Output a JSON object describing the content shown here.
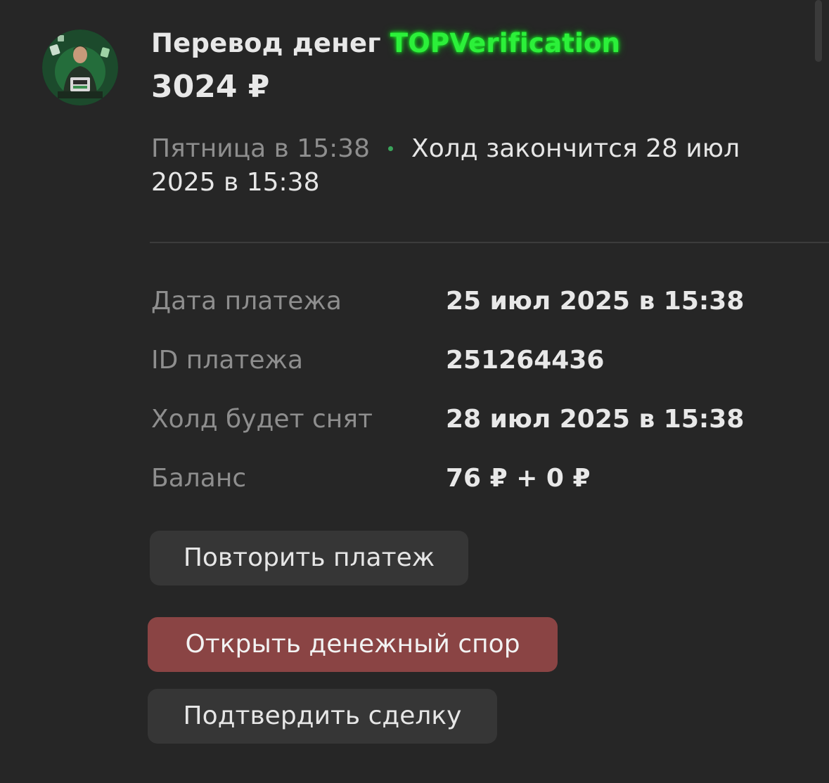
{
  "payment": {
    "title_prefix": "Перевод денег",
    "seller": "TOPVerification",
    "amount": "3024 ₽",
    "time": "Пятница в 15:38",
    "hold_notice_line1": "Холд закончится 28 июл",
    "hold_notice_line2": "2025 в 15:38"
  },
  "details": [
    {
      "label": "Дата платежа",
      "value": "25 июл 2025 в 15:38"
    },
    {
      "label": "ID платежа",
      "value": "251264436"
    },
    {
      "label": "Холд будет снят",
      "value": "28 июл 2025 в 15:38"
    },
    {
      "label": "Баланс",
      "value": "76 ₽ + 0 ₽"
    }
  ],
  "actions": {
    "repeat": "Повторить платеж",
    "dispute": "Открыть денежный спор",
    "confirm": "Подтвердить сделку"
  },
  "colors": {
    "background": "#262626",
    "seller_glow": "#2cf03a",
    "dispute_button": "#8a4444",
    "button": "#363636",
    "muted_text": "#8e8e8e",
    "status_dot": "#3aa35a"
  },
  "icons": {
    "avatar": "seller-avatar-image"
  }
}
